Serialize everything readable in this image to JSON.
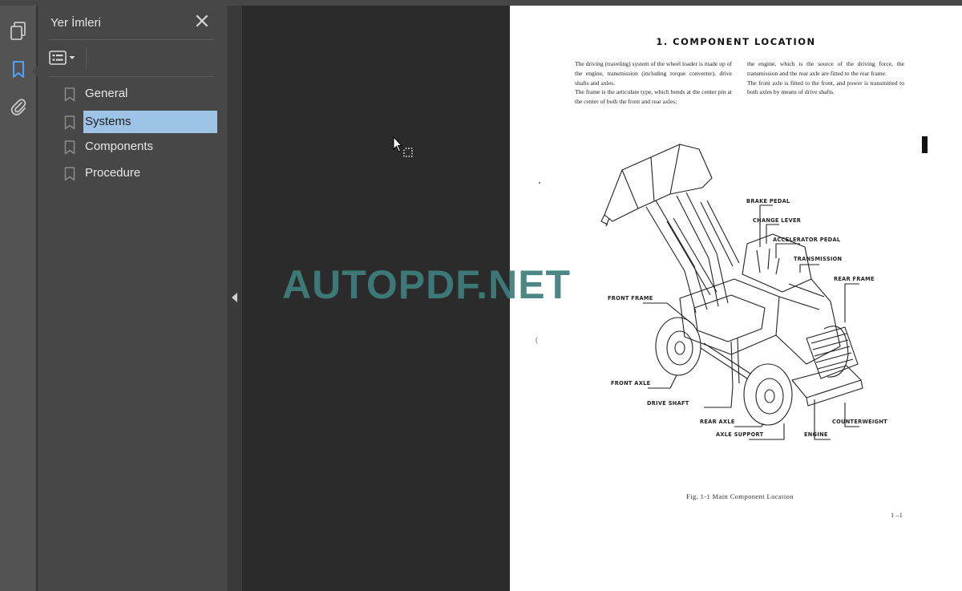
{
  "toolbar": {
    "icons": [
      "pages-icon",
      "bookmark-icon",
      "attachment-icon"
    ],
    "active": "bookmark-icon",
    "accent_color": "#4fa3f7"
  },
  "bookmarks_panel": {
    "title": "Yer İmleri",
    "items": [
      {
        "label": "General",
        "selected": false
      },
      {
        "label": "Systems",
        "selected": true
      },
      {
        "label": "Components",
        "selected": false
      },
      {
        "label": "Procedure",
        "selected": false
      }
    ],
    "selection_color": "#9dc3e6"
  },
  "document": {
    "title": "1.  COMPONENT  LOCATION",
    "paragraphs_col1": [
      "The driving (traveling) system of the wheel loader is made up of the engine, transmission (including torque converter), drive shafts and axles.",
      "The frame is the articulate type, which bends at the center pin at the center of both the front and rear axles;"
    ],
    "paragraphs_col2": [
      "the engine, which is the source of the driving force, the transmission and the rear axle are fitted to the rear frame.",
      "The front axle is fitted to the front, and power is transmitted to both axles by means of drive shafts."
    ],
    "figure_labels": {
      "brake_pedal": "BRAKE PEDAL",
      "change_lever": "CHANGE LEVER",
      "accelerator_pedal": "ACCELERATOR PEDAL",
      "transmission": "TRANSMISSION",
      "rear_frame": "REAR FRAME",
      "front_frame": "FRONT FRAME",
      "front_axle": "FRONT AXLE",
      "drive_shaft": "DRIVE SHAFT",
      "rear_axle": "REAR AXLE",
      "axle_support": "AXLE SUPPORT",
      "engine": "ENGINE",
      "counterweight": "COUNTERWEIGHT"
    },
    "figure_caption": "Fig. 1-1   Main Component Location",
    "page_number": "1 –1",
    "stray_mark": "("
  },
  "watermark": "AUTOPDF.NET"
}
